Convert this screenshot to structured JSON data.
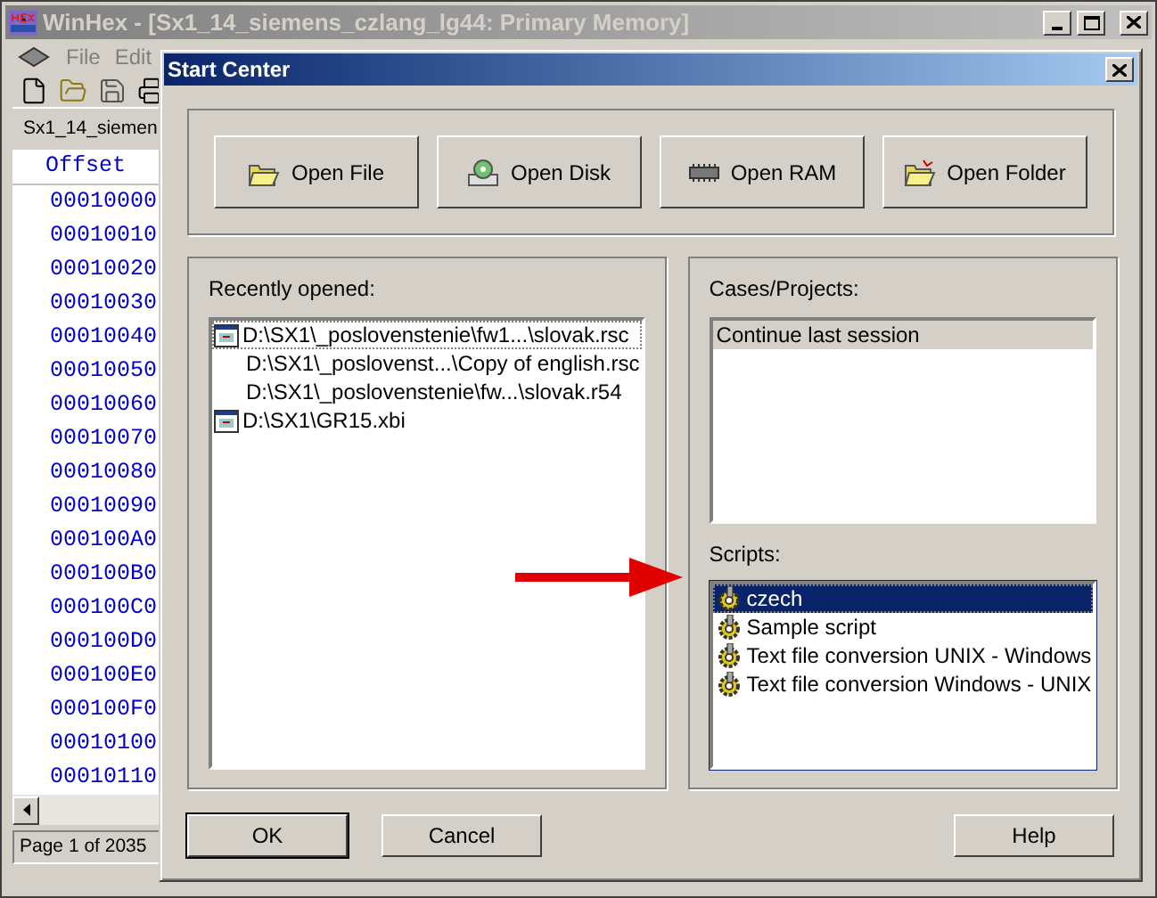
{
  "app_window": {
    "title": "WinHex - [Sx1_14_siemens_czlang_lg44: Primary Memory]",
    "active": false,
    "menu": [
      {
        "label": "File",
        "disabled": true
      },
      {
        "label": "Edit",
        "disabled": true
      }
    ],
    "tab": "Sx1_14_siemen",
    "offset_header": "Offset",
    "offsets": [
      "00010000",
      "00010010",
      "00010020",
      "00010030",
      "00010040",
      "00010050",
      "00010060",
      "00010070",
      "00010080",
      "00010090",
      "000100A0",
      "000100B0",
      "000100C0",
      "000100D0",
      "000100E0",
      "000100F0",
      "00010100",
      "00010110"
    ],
    "status_bar": "Page 1 of 2035"
  },
  "dialog": {
    "title": "Start Center",
    "buttons": [
      {
        "label": "Open File",
        "kind": "file"
      },
      {
        "label": "Open Disk",
        "kind": "disk"
      },
      {
        "label": "Open RAM",
        "kind": "ram"
      },
      {
        "label": "Open Folder",
        "kind": "folder"
      }
    ],
    "recent": {
      "label": "Recently opened:",
      "focused": false,
      "items": [
        {
          "text": "D:\\SX1\\_poslovenstenie\\fw1...\\slovak.rsc",
          "icon": true,
          "selected": false,
          "focused": true
        },
        {
          "text": "D:\\SX1\\_poslovenst...\\Copy of english.rsc",
          "icon": false,
          "selected": false,
          "focused": false
        },
        {
          "text": "D:\\SX1\\_poslovenstenie\\fw...\\slovak.r54",
          "icon": false,
          "selected": false,
          "focused": false
        },
        {
          "text": "D:\\SX1\\GR15.xbi",
          "icon": true,
          "selected": false,
          "focused": false
        }
      ]
    },
    "cases": {
      "label": "Cases/Projects:",
      "focused": false,
      "items": [
        {
          "text": "Continue last session",
          "selected": true
        }
      ]
    },
    "scripts": {
      "label": "Scripts:",
      "focused": true,
      "items": [
        {
          "text": "czech",
          "selected": true
        },
        {
          "text": "Sample script",
          "selected": false
        },
        {
          "text": "Text file conversion UNIX - Windows",
          "selected": false
        },
        {
          "text": "Text file conversion Windows - UNIX",
          "selected": false
        }
      ]
    },
    "footer": [
      {
        "label": "OK",
        "default": true
      },
      {
        "label": "Cancel",
        "default": false
      },
      {
        "label": "Help",
        "default": false
      }
    ]
  }
}
